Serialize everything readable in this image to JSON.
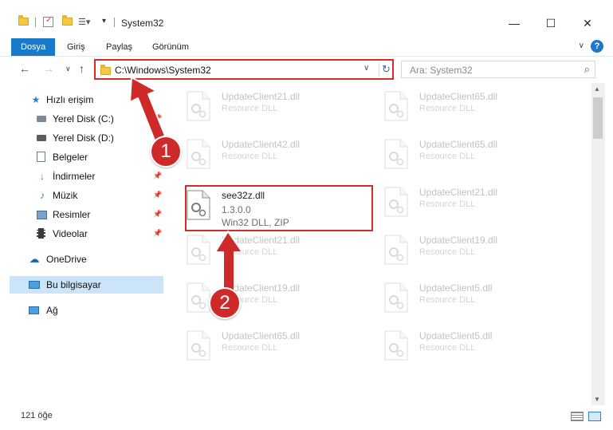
{
  "window": {
    "title": "System32",
    "controls": {
      "minimize": "—",
      "maximize": "☐",
      "close": "✕"
    }
  },
  "ribbon": {
    "tabs": [
      {
        "label": "Dosya",
        "active": true
      },
      {
        "label": "Giriş",
        "active": false
      },
      {
        "label": "Paylaş",
        "active": false
      },
      {
        "label": "Görünüm",
        "active": false
      }
    ],
    "help": "?"
  },
  "address_bar": {
    "path": "C:\\Windows\\System32",
    "refresh_icon": "refresh-icon"
  },
  "search": {
    "placeholder": "Ara: System32",
    "icon": "search-icon"
  },
  "sidebar": {
    "items": [
      {
        "label": "Hızlı erişim",
        "icon": "star-icon"
      },
      {
        "label": "Yerel Disk (C:)",
        "icon": "drive-icon"
      },
      {
        "label": "Yerel Disk (D:)",
        "icon": "drive-icon"
      },
      {
        "label": "Belgeler",
        "icon": "documents-icon"
      },
      {
        "label": "İndirmeler",
        "icon": "download-icon"
      },
      {
        "label": "Müzik",
        "icon": "music-icon"
      },
      {
        "label": "Resimler",
        "icon": "pictures-icon"
      },
      {
        "label": "Videolar",
        "icon": "video-icon"
      },
      {
        "label": "OneDrive",
        "icon": "cloud-icon"
      },
      {
        "label": "Bu bilgisayar",
        "icon": "computer-icon",
        "selected": true
      },
      {
        "label": "Ağ",
        "icon": "network-icon"
      }
    ]
  },
  "files": {
    "col1": [
      {
        "name": "UpdateClient21.dll",
        "type": "Resource DLL"
      },
      {
        "name": "UpdateClient42.dll",
        "type": "Resource DLL"
      },
      {
        "name": "see32z.dll",
        "version": "1.3.0.0",
        "type": "Win32 DLL, ZIP",
        "highlighted": true
      },
      {
        "name": "UpdateClient21.dll",
        "type": "Resource DLL"
      },
      {
        "name": "UpdateClient19.dll",
        "type": "Resource DLL"
      },
      {
        "name": "UpdateClient65.dll",
        "type": "Resource DLL"
      }
    ],
    "col2": [
      {
        "name": "UpdateClient65.dll",
        "type": "Resource DLL"
      },
      {
        "name": "UpdateClient65.dll",
        "type": "Resource DLL"
      },
      {
        "name": "UpdateClient21.dll",
        "type": "Resource DLL"
      },
      {
        "name": "UpdateClient19.dll",
        "type": "Resource DLL"
      },
      {
        "name": "UpdateClient5.dll",
        "type": "Resource DLL"
      },
      {
        "name": "UpdateClient5.dll",
        "type": "Resource DLL"
      }
    ]
  },
  "status": {
    "count_text": "121 öğe"
  },
  "annotations": {
    "step1": "1",
    "step2": "2",
    "color": "#cf2a2a"
  }
}
